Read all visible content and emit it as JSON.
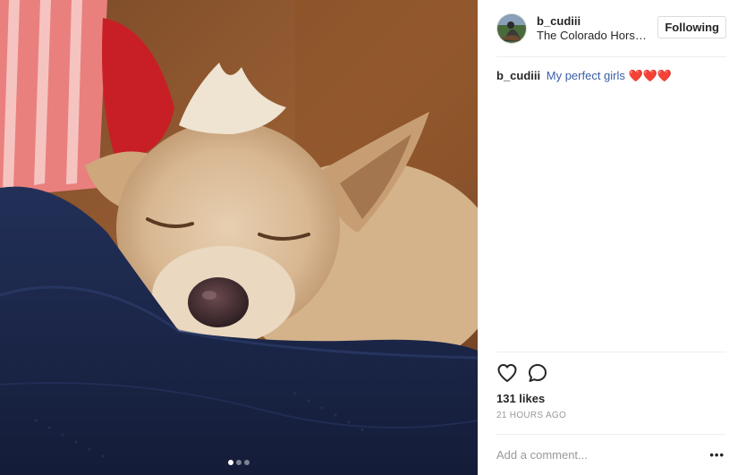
{
  "post": {
    "media": {
      "alt_icon": "photo-dog",
      "carousel": {
        "total": 3,
        "active": 0
      }
    },
    "header": {
      "username": "b_cudiii",
      "location": "The Colorado Horse Park",
      "follow_label": "Following"
    },
    "caption": {
      "author": "b_cudiii",
      "text": "My perfect girls",
      "emoji": "❤️❤️❤️"
    },
    "actions": {
      "like_icon": "heart-icon",
      "comment_icon": "comment-icon"
    },
    "likes": "131 likes",
    "timestamp": "21 HOURS AGO",
    "add_comment": {
      "placeholder": "Add a comment...",
      "more_label": "•••"
    },
    "colors": {
      "link_blue": "#3b5ea7",
      "border": "#efefef",
      "muted": "#999999"
    }
  }
}
